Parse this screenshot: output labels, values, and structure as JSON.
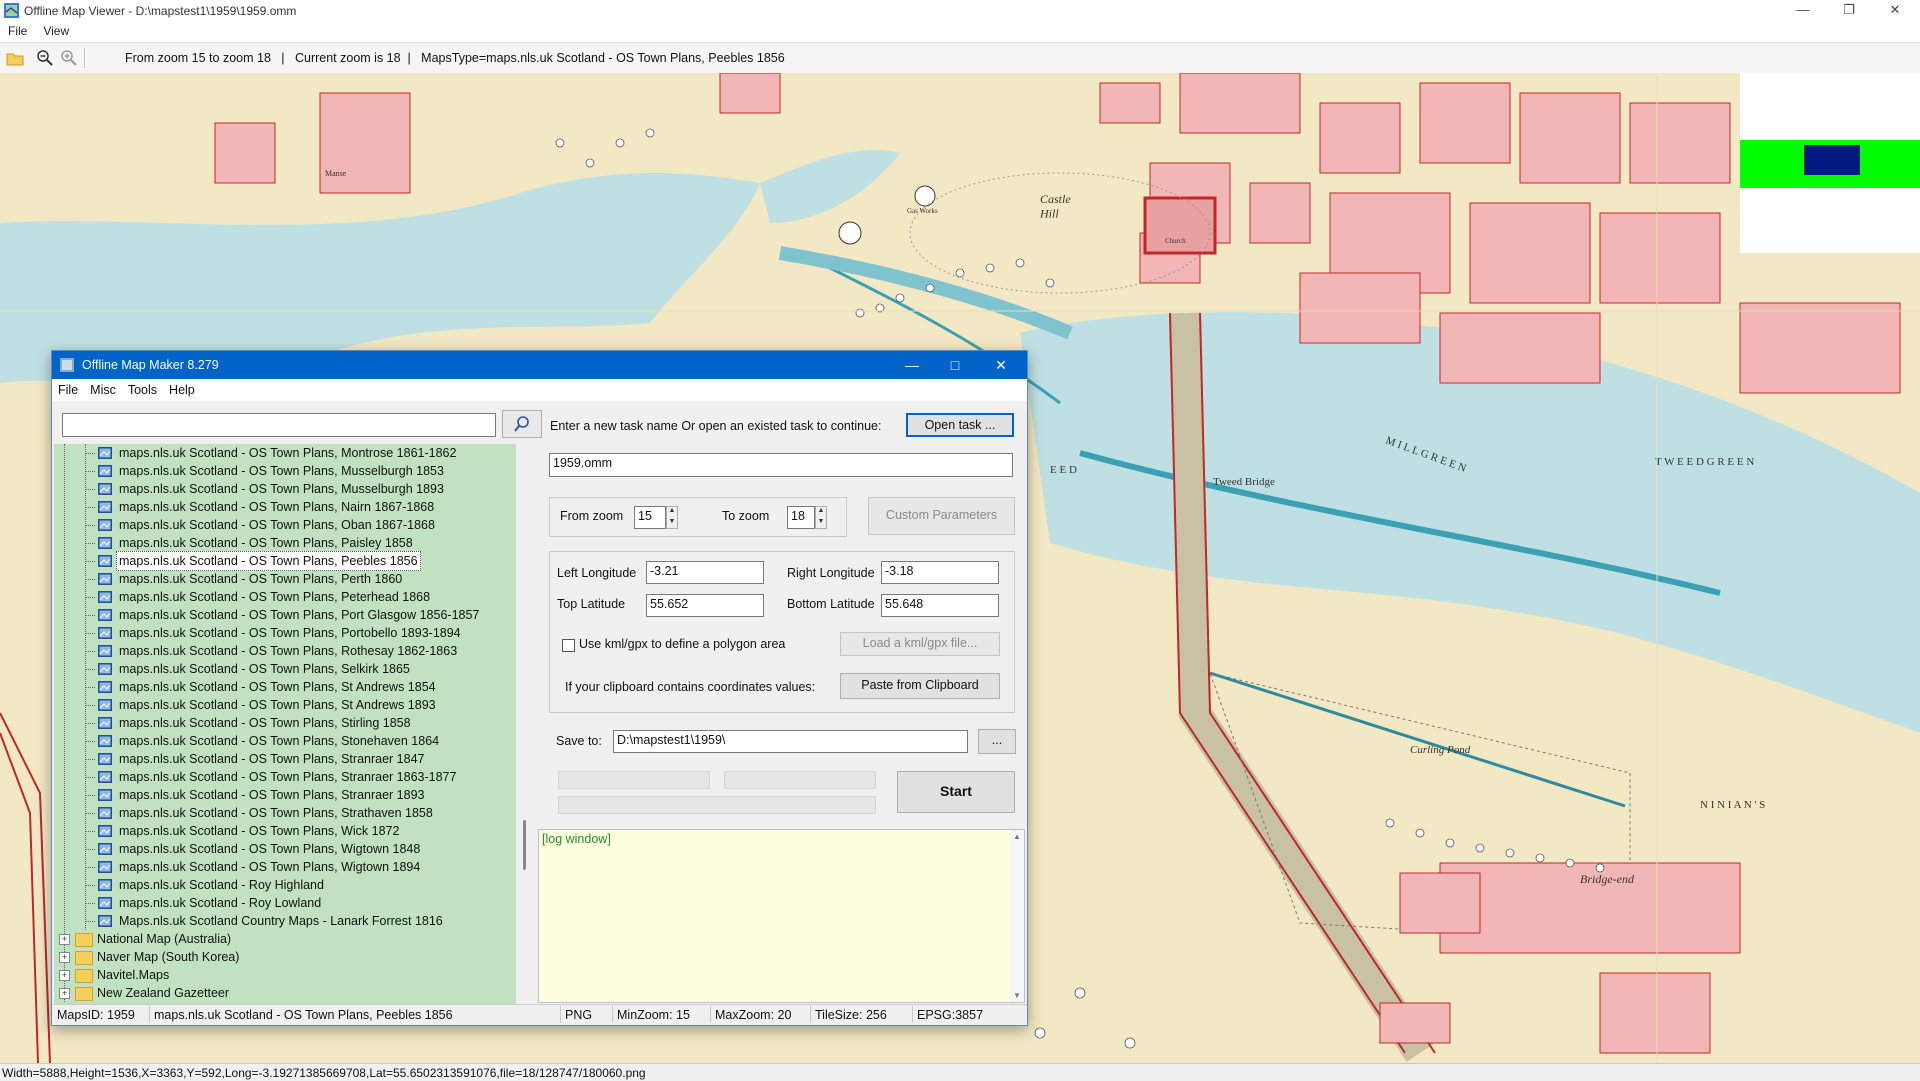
{
  "viewer": {
    "title": "Offline Map Viewer - D:\\mapstest1\\1959\\1959.omm",
    "menu": [
      "File",
      "View"
    ],
    "toolbar_info": "From zoom 15 to zoom 18   |   Current zoom is 18  |   MapsType=maps.nls.uk Scotland - OS Town Plans, Peebles 1856",
    "status": "Width=5888,Height=1536,X=3363,Y=592,Long=-3.19271385669708,Lat=55.6502313591076,file=18/128747/180060.png",
    "map_labels": {
      "castle_hill": "Castle\nHill",
      "tweed_bridge": "Tweed Bridge",
      "mill_green": "M I L L   G R E E N",
      "tweed_green": "T W E E D   G R E E N",
      "curling_pond": "Curling  Pond",
      "bridge_end": "Bridge-end",
      "ninians": "N I N I A N ' S",
      "manse": "Manse",
      "gas_works": "Gas Works",
      "church": "Church",
      "eed": "E E D"
    },
    "colors": {
      "indicator_outer": "#00ff00",
      "indicator_inner": "#001a80",
      "water": "#b8dbe0",
      "land": "#f3e8c4",
      "buildings": "#f2b6b6"
    }
  },
  "dialog": {
    "title": "Offline Map Maker 8.279",
    "menu": [
      "File",
      "Misc",
      "Tools",
      "Help"
    ],
    "search_value": "",
    "task_prompt": "Enter a new task name Or open an existed task to continue:",
    "open_task_label": "Open task ...",
    "task_name": "1959.omm",
    "from_zoom_label": "From zoom",
    "from_zoom": "15",
    "to_zoom_label": "To zoom",
    "to_zoom": "18",
    "custom_params_label": "Custom Parameters",
    "left_long_label": "Left Longitude",
    "left_long": "-3.21",
    "right_long_label": "Right Longitude",
    "right_long": "-3.18",
    "top_lat_label": "Top Latitude",
    "top_lat": "55.652",
    "bottom_lat_label": "Bottom Latitude",
    "bottom_lat": "55.648",
    "kml_label": "Use kml/gpx to define a polygon area",
    "load_kml_label": "Load a kml/gpx file...",
    "clipboard_prompt": "If your clipboard contains coordinates values:",
    "paste_label": "Paste from Clipboard",
    "save_to_label": "Save to:",
    "save_to": "D:\\mapstest1\\1959\\",
    "browse_label": "...",
    "start_label": "Start",
    "log_text": "[log window]",
    "tree_items": [
      "maps.nls.uk Scotland - OS Town Plans, Montrose 1861-1862",
      "maps.nls.uk Scotland - OS Town Plans, Musselburgh 1853",
      "maps.nls.uk Scotland - OS Town Plans, Musselburgh 1893",
      "maps.nls.uk Scotland - OS Town Plans, Nairn 1867-1868",
      "maps.nls.uk Scotland - OS Town Plans, Oban 1867-1868",
      "maps.nls.uk Scotland - OS Town Plans, Paisley 1858",
      "maps.nls.uk Scotland - OS Town Plans, Peebles 1856",
      "maps.nls.uk Scotland - OS Town Plans, Perth 1860",
      "maps.nls.uk Scotland - OS Town Plans, Peterhead 1868",
      "maps.nls.uk Scotland - OS Town Plans, Port Glasgow 1856-1857",
      "maps.nls.uk Scotland - OS Town Plans, Portobello 1893-1894",
      "maps.nls.uk Scotland - OS Town Plans, Rothesay 1862-1863",
      "maps.nls.uk Scotland - OS Town Plans, Selkirk 1865",
      "maps.nls.uk Scotland - OS Town Plans, St Andrews 1854",
      "maps.nls.uk Scotland - OS Town Plans, St Andrews 1893",
      "maps.nls.uk Scotland - OS Town Plans, Stirling 1858",
      "maps.nls.uk Scotland - OS Town Plans, Stonehaven 1864",
      "maps.nls.uk Scotland - OS Town Plans, Stranraer 1847",
      "maps.nls.uk Scotland - OS Town Plans, Stranraer 1863-1877",
      "maps.nls.uk Scotland - OS Town Plans, Stranraer 1893",
      "maps.nls.uk Scotland - OS Town Plans, Strathaven 1858",
      "maps.nls.uk Scotland - OS Town Plans, Wick 1872",
      "maps.nls.uk Scotland - OS Town Plans, Wigtown 1848",
      "maps.nls.uk Scotland - OS Town Plans, Wigtown 1894",
      "maps.nls.uk Scotland - Roy Highland",
      "maps.nls.uk Scotland - Roy Lowland",
      "Maps.nls.uk Scotland Country Maps - Lanark Forrest 1816"
    ],
    "tree_folders": [
      "National Map (Australia)",
      "Naver Map (South Korea)",
      "Navitel.Maps",
      "New Zealand Gazetteer"
    ],
    "selected_item": "maps.nls.uk Scotland - OS Town Plans, Peebles 1856",
    "status": {
      "maps_id": "MapsID: 1959",
      "name": "maps.nls.uk Scotland - OS Town Plans, Peebles 1856",
      "format": "PNG",
      "min_zoom": "MinZoom: 15",
      "max_zoom": "MaxZoom: 20",
      "tile_size": "TileSize: 256",
      "epsg": "EPSG:3857"
    }
  }
}
